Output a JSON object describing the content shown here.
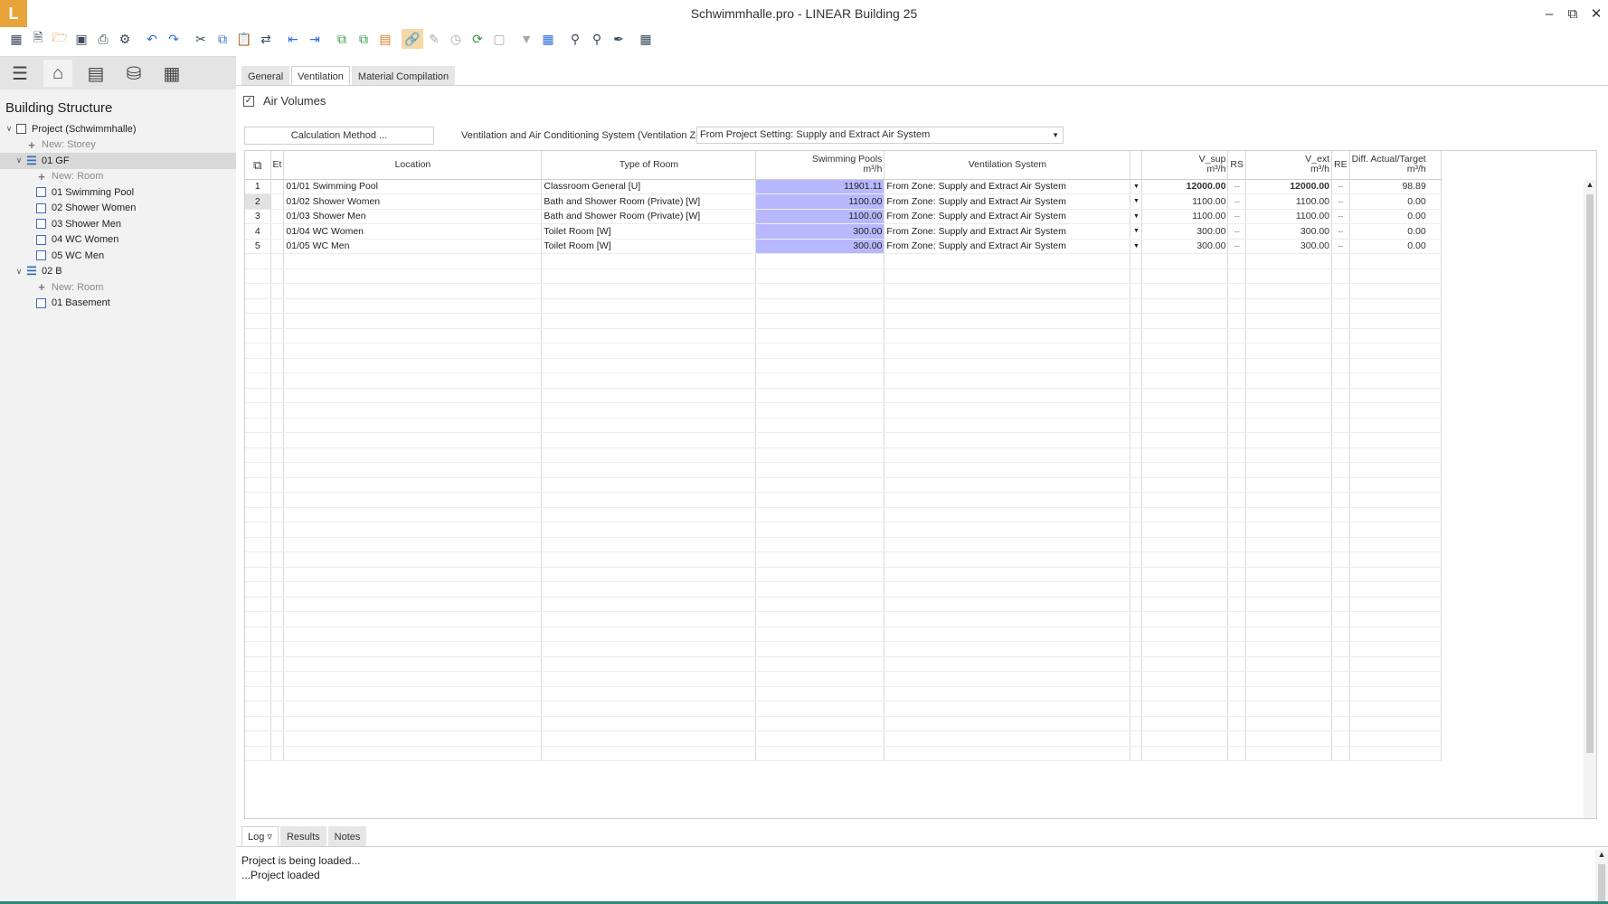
{
  "window": {
    "title": "Schwimmhalle.pro - LINEAR Building 25",
    "logo": "L",
    "controls": [
      "minimize-icon",
      "restore-icon",
      "close-icon"
    ]
  },
  "toolbar": {
    "icons": [
      "apps-grid-icon",
      "new-file-icon",
      "open-folder-icon",
      "save-icon",
      "print-icon",
      "settings-gear-icon",
      "undo-icon",
      "redo-icon",
      "cut-icon",
      "copy-icon",
      "paste-icon",
      "replace-icon",
      "import-icon",
      "export-icon",
      "add-document-icon",
      "copy-document-icon",
      "report-icon",
      "link-icon",
      "edit-pencil-icon",
      "history-icon",
      "refresh-icon",
      "reset-icon",
      "filter-icon",
      "chart-icon",
      "search-icon",
      "search-replace-icon",
      "pipette-icon",
      "calculator-icon"
    ]
  },
  "sidebar": {
    "tabs": [
      "menu-icon",
      "building-icon",
      "list-icon",
      "database-icon",
      "calculator-icon"
    ],
    "title": "Building Structure",
    "tree": [
      {
        "label": "Project (Schwimmhalle)",
        "level": 0,
        "kind": "project",
        "expanded": true
      },
      {
        "label": "New: Storey",
        "level": 1,
        "kind": "new"
      },
      {
        "label": "01 GF",
        "level": 1,
        "kind": "storey",
        "expanded": true,
        "selected": true
      },
      {
        "label": "New: Room",
        "level": 2,
        "kind": "new"
      },
      {
        "label": "01 Swimming Pool",
        "level": 2,
        "kind": "room"
      },
      {
        "label": "02 Shower Women",
        "level": 2,
        "kind": "room"
      },
      {
        "label": "03 Shower Men",
        "level": 2,
        "kind": "room"
      },
      {
        "label": "04 WC Women",
        "level": 2,
        "kind": "room"
      },
      {
        "label": "05 WC Men",
        "level": 2,
        "kind": "room"
      },
      {
        "label": "02 B",
        "level": 1,
        "kind": "storey",
        "expanded": true
      },
      {
        "label": "New: Room",
        "level": 2,
        "kind": "new"
      },
      {
        "label": "01 Basement",
        "level": 2,
        "kind": "room"
      }
    ]
  },
  "main": {
    "tabs": [
      "General",
      "Ventilation",
      "Material Compilation"
    ],
    "active_tab": "Ventilation",
    "air_volumes_label": "Air Volumes",
    "air_volumes_checked": true,
    "calc_method_label": "Calculation Method ...",
    "vent_zone_label": "Ventilation and Air Conditioning System (Ventilation Zone)",
    "vent_zone_value": "From Project Setting: Supply and Extract Air System",
    "columns": {
      "et": "Et",
      "location": "Location",
      "type": "Type of Room",
      "pools": "Swimming Pools",
      "pools_unit": "m³/h",
      "vent": "Ventilation System",
      "vsup": "V_sup",
      "vsup_unit": "m³/h",
      "rs": "RS",
      "vext": "V_ext",
      "vext_unit": "m³/h",
      "re": "RE",
      "diff": "Diff. Actual/Target",
      "diff_unit": "m³/h"
    },
    "rows": [
      {
        "n": "1",
        "location": "01/01 Swimming Pool",
        "type": "Classroom General [U]",
        "pools": "11901.11",
        "vent": "From Zone: Supply and Extract Air System",
        "vsup": "12000.00",
        "rs": "--",
        "vext": "12000.00",
        "re": "--",
        "diff": "98.89",
        "bold": true
      },
      {
        "n": "2",
        "location": "01/02 Shower Women",
        "type": "Bath and Shower Room (Private) [W]",
        "pools": "1100.00",
        "vent": "From Zone: Supply and Extract Air System",
        "vsup": "1100.00",
        "rs": "--",
        "vext": "1100.00",
        "re": "--",
        "diff": "0.00",
        "bold": false
      },
      {
        "n": "3",
        "location": "01/03 Shower Men",
        "type": "Bath and Shower Room (Private) [W]",
        "pools": "1100.00",
        "vent": "From Zone: Supply and Extract Air System",
        "vsup": "1100.00",
        "rs": "--",
        "vext": "1100.00",
        "re": "--",
        "diff": "0.00",
        "bold": false
      },
      {
        "n": "4",
        "location": "01/04 WC Women",
        "type": "Toilet Room [W]",
        "pools": "300.00",
        "vent": "From Zone: Supply and Extract Air System",
        "vsup": "300.00",
        "rs": "--",
        "vext": "300.00",
        "re": "--",
        "diff": "0.00",
        "bold": false
      },
      {
        "n": "5",
        "location": "01/05 WC Men",
        "type": "Toilet Room [W]",
        "pools": "300.00",
        "vent": "From Zone: Supply and Extract Air System",
        "vsup": "300.00",
        "rs": "--",
        "vext": "300.00",
        "re": "--",
        "diff": "0.00",
        "bold": false
      }
    ],
    "empty_rows": 34
  },
  "log": {
    "tabs": [
      "Log",
      "Results",
      "Notes"
    ],
    "lines": [
      "Project is being loaded...",
      "...Project loaded"
    ]
  }
}
